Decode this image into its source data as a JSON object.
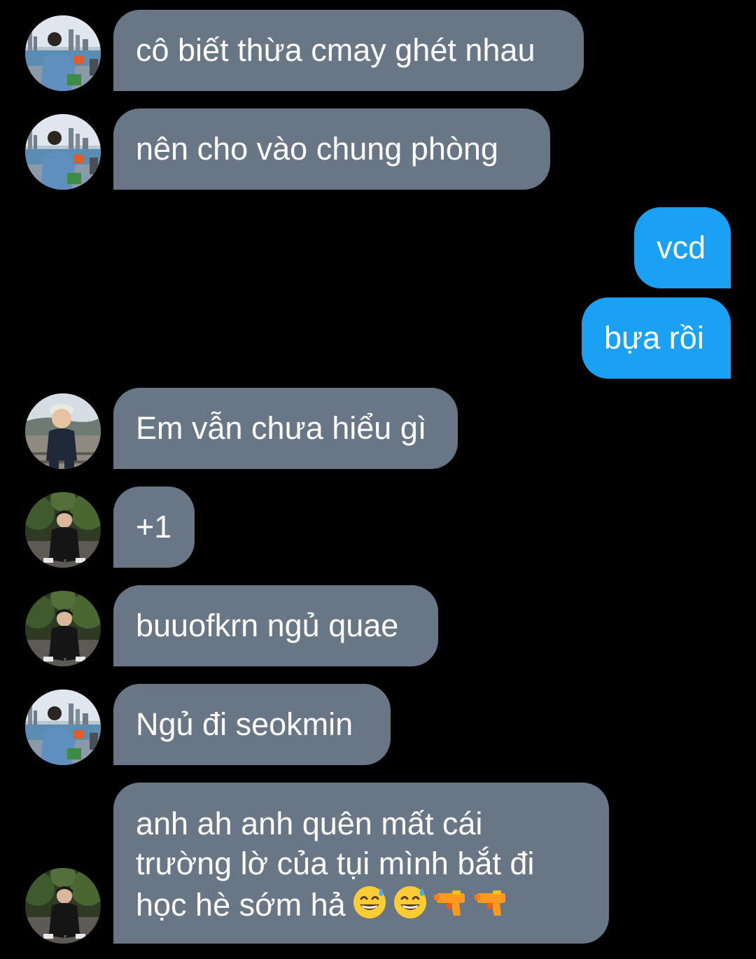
{
  "messages": [
    {
      "side": "in",
      "avatar": "avatar-blue-jacket",
      "text": "cô biết thừa cmay ghét nhau"
    },
    {
      "side": "in",
      "avatar": "avatar-blue-jacket",
      "text": "nên cho vào chung phòng"
    },
    {
      "side": "out",
      "text": "vcd"
    },
    {
      "side": "out",
      "text": "bựa rồi"
    },
    {
      "side": "in",
      "avatar": "avatar-child-cap",
      "text": "Em vẫn chưa hiểu gì"
    },
    {
      "side": "in",
      "avatar": "avatar-dark-garden",
      "text": "+1"
    },
    {
      "side": "in",
      "avatar": "avatar-dark-garden",
      "text": "buuofkrn ngủ quae"
    },
    {
      "side": "in",
      "avatar": "avatar-blue-jacket",
      "text": "Ngủ đi seokmin"
    },
    {
      "side": "in",
      "avatar": "avatar-dark-garden",
      "lines": [
        "anh ah anh quên mất cái",
        "trường lờ của tụi mình bắt đi",
        "học hè sớm hả"
      ],
      "emojis": [
        "grinning-sweat-emoji",
        "grinning-sweat-emoji",
        "water-pistol-emoji",
        "water-pistol-emoji"
      ]
    }
  ],
  "colors": {
    "background": "#000000",
    "incoming_bubble": "#687686",
    "outgoing_bubble": "#1ba1f3",
    "text": "#ffffff"
  }
}
